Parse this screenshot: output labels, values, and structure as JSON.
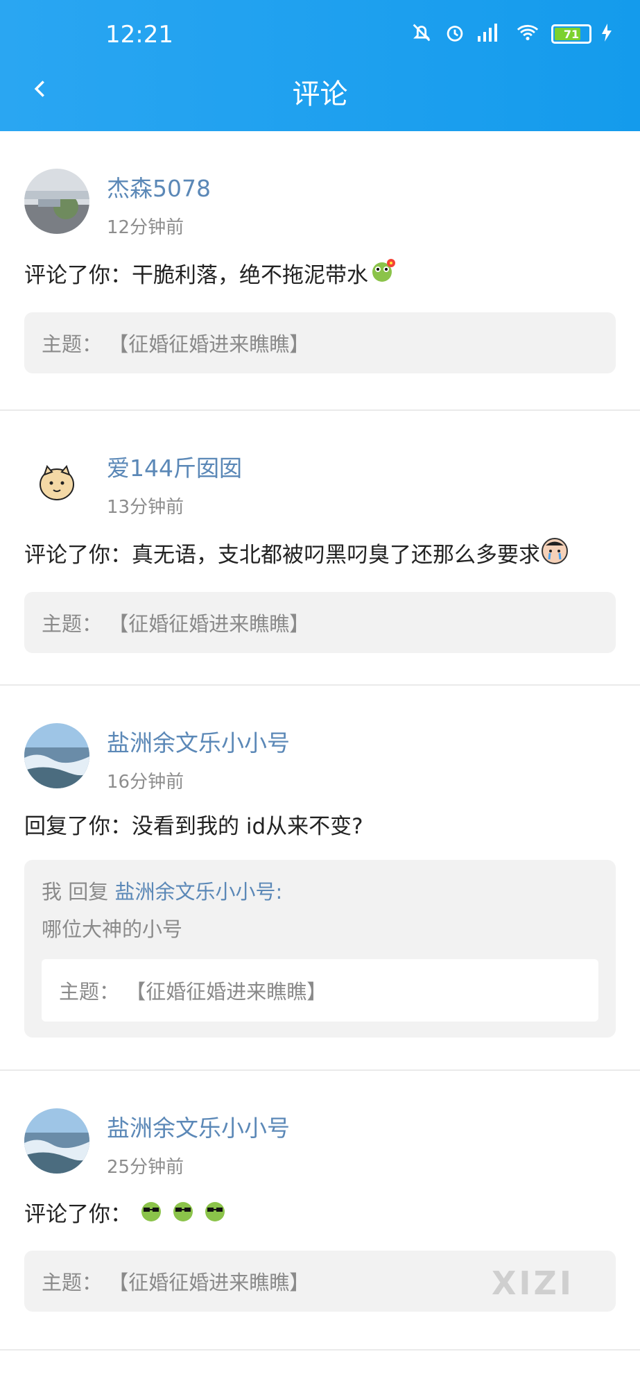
{
  "status": {
    "time": "12:21",
    "battery_level": "71"
  },
  "header": {
    "title": "评论"
  },
  "items": [
    {
      "name": "杰森5078",
      "time": "12分钟前",
      "content": "评论了你：干脆利落，绝不拖泥带水",
      "topic_prefix": "主题：",
      "topic": "【征婚征婚进来瞧瞧】"
    },
    {
      "name": "爱144斤囡囡",
      "time": "13分钟前",
      "content": "评论了你：真无语，支北都被叼黑叼臭了还那么多要求",
      "topic_prefix": "主题：",
      "topic": "【征婚征婚进来瞧瞧】"
    },
    {
      "name": "盐洲余文乐小小号",
      "time": "16分钟前",
      "content": "回复了你：没看到我的 id从来不变?",
      "reply_prefix": "我 回复",
      "reply_target": "盐洲余文乐小小号:",
      "reply_text": "哪位大神的小号",
      "topic_prefix": "主题：",
      "topic": "【征婚征婚进来瞧瞧】"
    },
    {
      "name": "盐洲余文乐小小号",
      "time": "25分钟前",
      "content": "评论了你：",
      "topic_prefix": "主题：",
      "topic": "【征婚征婚进来瞧瞧】",
      "watermark": "XIZI"
    }
  ],
  "colors": {
    "header": "#1aa0ee",
    "name": "#5b88b7",
    "box": "#f2f2f2"
  }
}
